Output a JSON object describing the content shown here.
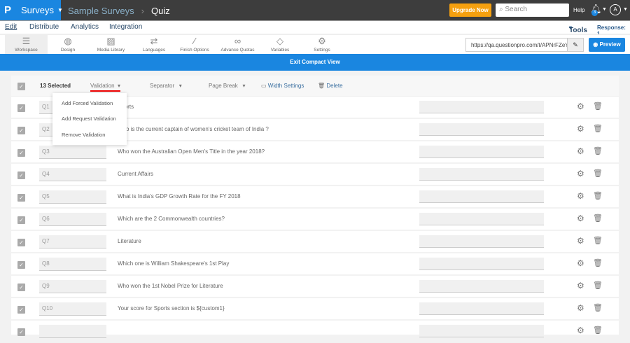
{
  "header": {
    "brand": "Surveys",
    "breadcrumb": [
      "Sample Surveys",
      "Quiz"
    ],
    "upgrade": "Upgrade Now",
    "search_placeholder": "Search",
    "help": "Help",
    "notifications": "3",
    "avatar": "A"
  },
  "nav": {
    "items": [
      "Edit",
      "Distribute",
      "Analytics",
      "Integration"
    ],
    "tools": "Tools",
    "response": "Response: 1"
  },
  "toolbar": {
    "items": [
      "Workspace",
      "Design",
      "Media Library",
      "Languages",
      "Finish Options",
      "Advance Quotas",
      "Variables",
      "Settings"
    ],
    "url": "https://qa.questionpro.com/t/APNrFZeY",
    "preview": "Preview"
  },
  "exit": "Exit Compact View",
  "bulk": {
    "selected": "13 Selected",
    "validation": "Validation",
    "separator": "Separator",
    "page_break": "Page Break",
    "width_settings": "Width Settings",
    "delete": "Delete"
  },
  "validation_menu": [
    "Add Forced Validation",
    "Add Request Validation",
    "Remove Validation"
  ],
  "questions": [
    {
      "id": "Q1",
      "text": "Sports"
    },
    {
      "id": "Q2",
      "text": "Who is the current captain of women's cricket team of India ?"
    },
    {
      "id": "Q3",
      "text": "Who won the Australian Open Men's Title in the year 2018?"
    },
    {
      "id": "Q4",
      "text": "Current Affairs"
    },
    {
      "id": "Q5",
      "text": "What is India's GDP Growth Rate for the FY 2018"
    },
    {
      "id": "Q6",
      "text": "Which are the 2 Commonwealth countries?"
    },
    {
      "id": "Q7",
      "text": "Literature"
    },
    {
      "id": "Q8",
      "text": "Which one is William Shakespeare's 1st Play"
    },
    {
      "id": "Q9",
      "text": "Who won the 1st Nobel Prize for Literature"
    },
    {
      "id": "Q10",
      "text": "Your score for Sports section is ${custom1}"
    },
    {
      "id": "",
      "text": ""
    }
  ]
}
